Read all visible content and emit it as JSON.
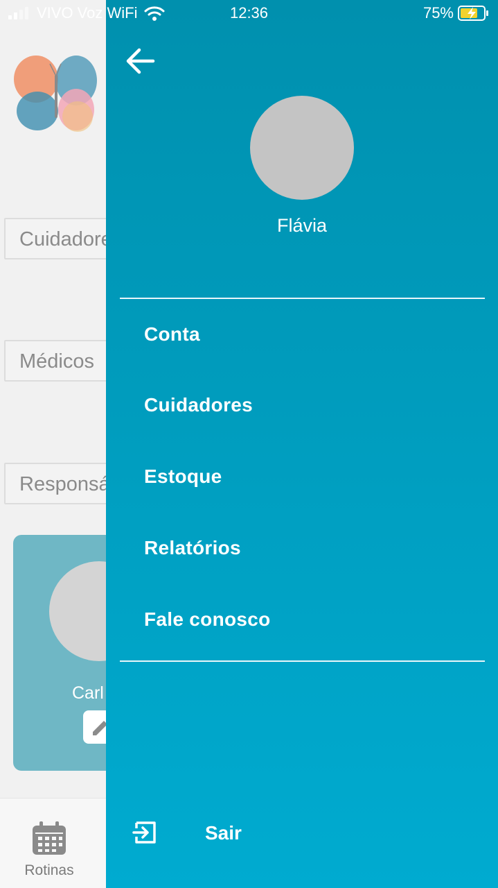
{
  "status_bar": {
    "carrier": "VIVO Voz WiFi",
    "time": "12:36",
    "battery_percent": "75%",
    "battery_level": 0.75,
    "charging": true
  },
  "background": {
    "fields": [
      {
        "placeholder": "Cuidadores"
      },
      {
        "placeholder": "Médicos"
      },
      {
        "placeholder": "Responsável"
      }
    ],
    "patient_card": {
      "name": "Carl",
      "accent": "#6fb7c5"
    },
    "bottom_nav": {
      "rotinas_label": "Rotinas"
    }
  },
  "drawer": {
    "gradient_top": "#0090ae",
    "gradient_bottom": "#00abd0",
    "user_name": "Flávia",
    "menu": [
      {
        "label": "Conta"
      },
      {
        "label": "Cuidadores"
      },
      {
        "label": "Estoque"
      },
      {
        "label": "Relatórios"
      },
      {
        "label": "Fale conosco"
      }
    ],
    "logout_label": "Sair"
  }
}
